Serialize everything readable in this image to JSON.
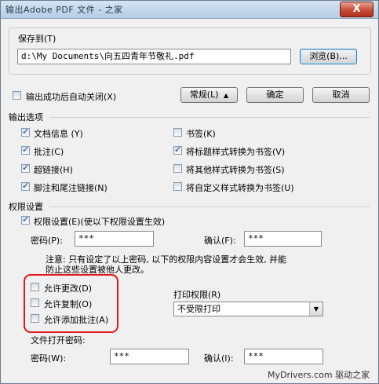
{
  "window": {
    "title": "输出Adobe PDF 文件 - 之家",
    "close_glyph": "X"
  },
  "save_to": {
    "label": "保存到(T)",
    "path": "d:\\My Documents\\向五四青年节敬礼.pdf",
    "browse_label": "浏览(B)..."
  },
  "top_controls": {
    "auto_close_label": "输出成功后自动关闭(X)",
    "auto_close_checked": false,
    "general_label": "常规(L)",
    "general_arrow": "▲",
    "ok_label": "确定",
    "cancel_label": "取消"
  },
  "output_options": {
    "header": "输出选项",
    "left": [
      {
        "label": "文档信息 (Y)",
        "checked": true
      },
      {
        "label": "批注(C)",
        "checked": true
      },
      {
        "label": "超链接(H)",
        "checked": true
      },
      {
        "label": "脚注和尾注链接(N)",
        "checked": true
      }
    ],
    "right": [
      {
        "label": "书签(K)",
        "checked": false
      },
      {
        "label": "将标题样式转换为书签(V)",
        "checked": true
      },
      {
        "label": "将其他样式转换为书签(S)",
        "checked": false
      },
      {
        "label": "将自定义样式转换为书签(U)",
        "checked": false
      }
    ]
  },
  "permissions": {
    "header": "权限设置",
    "enable_label": "权限设置(E)(使以下权限设置生效)",
    "enable_checked": true,
    "password_label": "密码(P):",
    "password_value": "***",
    "confirm_label": "确认(F):",
    "confirm_value": "***",
    "note_line1": "注意: 只有设定了以上密码, 以下的权限内容设置才会生效, 并能",
    "note_line2": "防止这些设置被他人更改。",
    "allow_items": [
      {
        "label": "允许更改(D)",
        "checked": false
      },
      {
        "label": "允许复制(O)",
        "checked": false
      },
      {
        "label": "允许添加批注(A)",
        "checked": false
      }
    ],
    "print_label": "打印权限(R)",
    "print_value": "不受限打印",
    "open_pw_header": "文件打开密码:",
    "open_pw_label": "密码(W):",
    "open_pw_value": "***",
    "open_confirm_label": "确认(I):",
    "open_confirm_value": "***"
  },
  "watermark": "MyDrivers.com 驱动之家"
}
